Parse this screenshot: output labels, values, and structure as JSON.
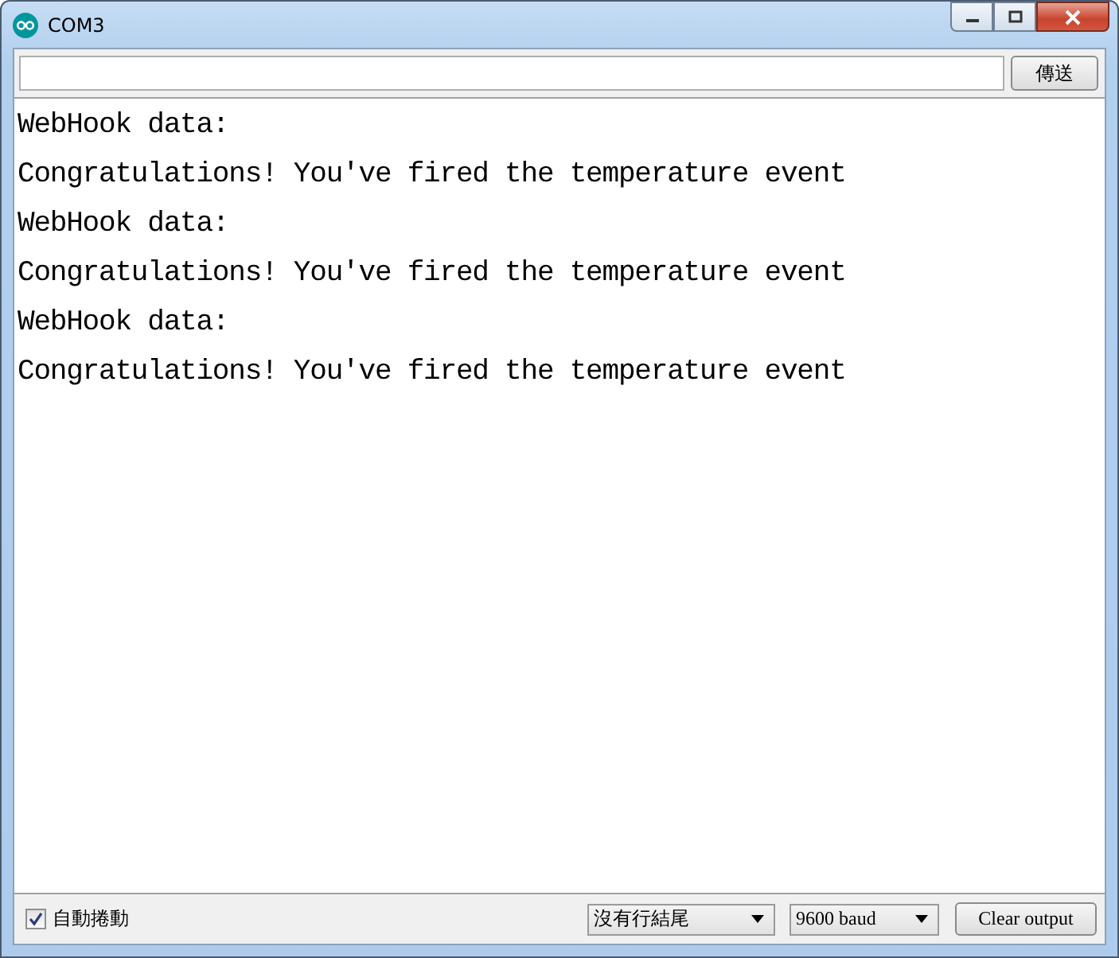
{
  "window": {
    "title": "COM3"
  },
  "send_button": "傳送",
  "output_lines": [
    "WebHook data:",
    "Congratulations! You've fired the temperature event",
    "WebHook data:",
    "Congratulations! You've fired the temperature event",
    "WebHook data:",
    "Congratulations! You've fired the temperature event"
  ],
  "autoscroll": {
    "label": "自動捲動",
    "checked": true
  },
  "line_ending": {
    "value": "沒有行結尾"
  },
  "baud": {
    "value": "9600 baud"
  },
  "clear_button": "Clear output"
}
